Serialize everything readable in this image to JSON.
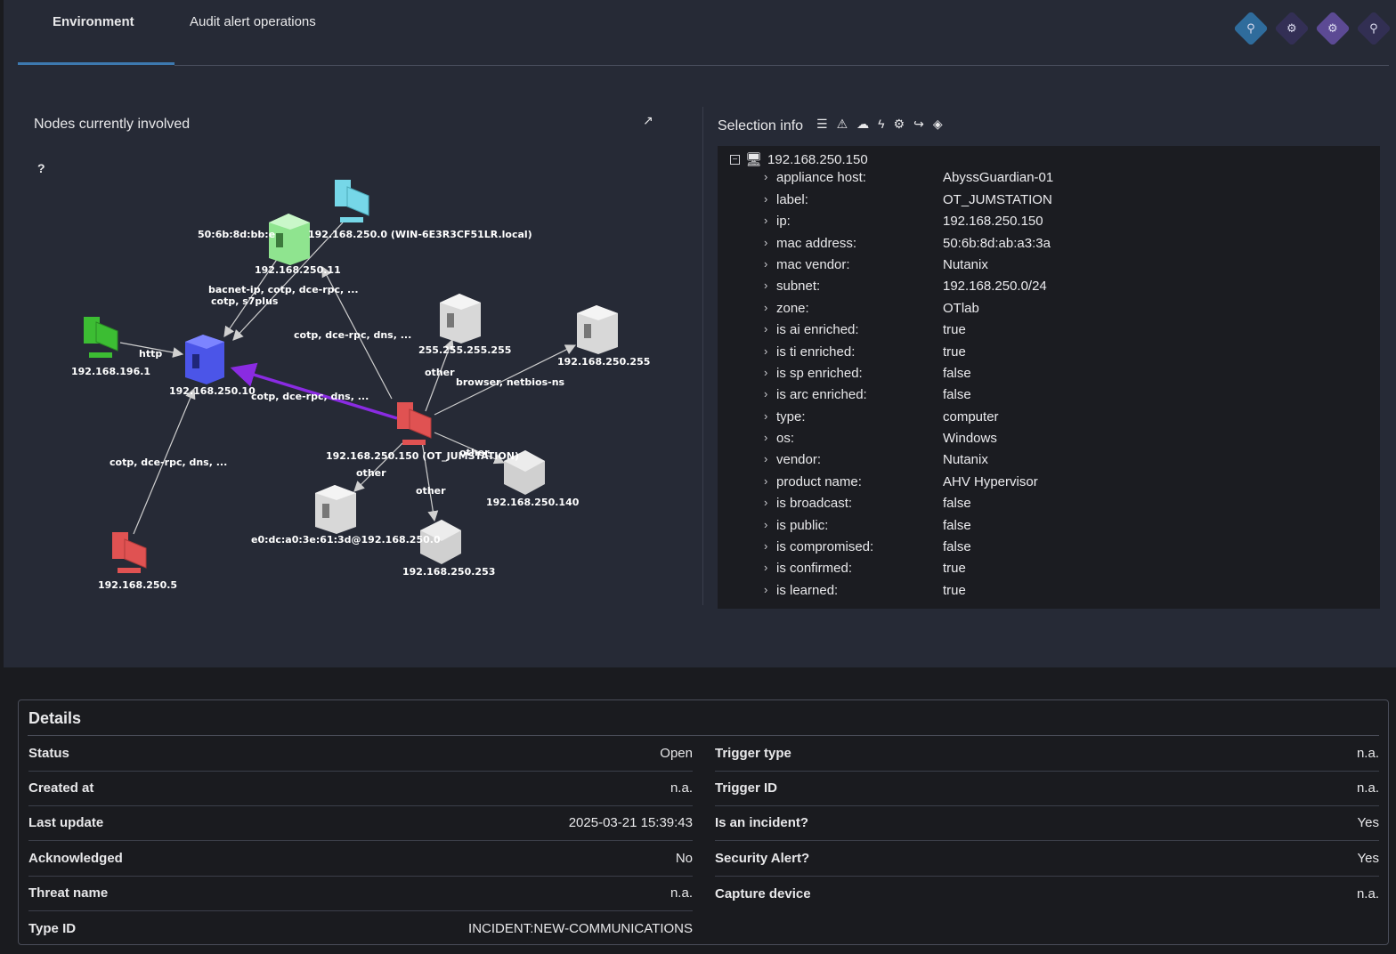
{
  "tabs": [
    {
      "label": "Environment",
      "active": true
    },
    {
      "label": "Audit alert operations",
      "active": false
    }
  ],
  "header_icons": [
    "appliance-icon",
    "settings-cog-icon",
    "network-node-icon",
    "extra-icon"
  ],
  "graph": {
    "title": "Nodes currently involved",
    "help": "?",
    "nodes": [
      {
        "id": "n10",
        "label": "192.168.250.10",
        "kind": "plc",
        "color": "#4b55e8"
      },
      {
        "id": "n1",
        "label": "192.168.196.1",
        "kind": "computer",
        "color": "#3cbd33"
      },
      {
        "id": "n11",
        "label": "192.168.250.11",
        "kind": "plc",
        "color": "#8fe48f"
      },
      {
        "id": "nwin",
        "label": "192.168.250.0 (WIN-6E3R3CF51LR.local)",
        "kind": "computer",
        "color": "#76d7e8"
      },
      {
        "id": "nmac",
        "label": "50:6b:8d:bb:e",
        "kind": "text",
        "color": "#ffffff"
      },
      {
        "id": "n255",
        "label": "255.255.255.255",
        "kind": "plc",
        "color": "#d8d8d8"
      },
      {
        "id": "n250255",
        "label": "192.168.250.255",
        "kind": "plc",
        "color": "#d8d8d8"
      },
      {
        "id": "n150",
        "label": "192.168.250.150 (OT_JUMSTATION)",
        "kind": "computer",
        "color": "#e05252"
      },
      {
        "id": "n140",
        "label": "192.168.250.140",
        "kind": "cube",
        "color": "#d8d8d8"
      },
      {
        "id": "n253",
        "label": "192.168.250.253",
        "kind": "cube",
        "color": "#d8d8d8"
      },
      {
        "id": "ne0",
        "label": "e0:dc:a0:3e:61:3d@192.168.250.0",
        "kind": "plc",
        "color": "#d8d8d8"
      },
      {
        "id": "n5",
        "label": "192.168.250.5",
        "kind": "computer",
        "color": "#e05252"
      }
    ],
    "edge_labels": [
      "bacnet-ip, cotp, dce-rpc, ...",
      "cotp, s7plus",
      "http",
      "cotp, dce-rpc, dns, ...",
      "cotp, dce-rpc, dns, ...",
      "other",
      "browser, netbios-ns",
      "other",
      "other",
      "other",
      "cotp, dce-rpc, dns, ..."
    ]
  },
  "selection": {
    "title": "Selection info",
    "root": "192.168.250.150",
    "rows": [
      {
        "key": "appliance host:",
        "value": "AbyssGuardian-01"
      },
      {
        "key": "label:",
        "value": "OT_JUMSTATION"
      },
      {
        "key": "ip:",
        "value": "192.168.250.150"
      },
      {
        "key": "mac address:",
        "value": "50:6b:8d:ab:a3:3a"
      },
      {
        "key": "mac vendor:",
        "value": "Nutanix"
      },
      {
        "key": "subnet:",
        "value": "192.168.250.0/24"
      },
      {
        "key": "zone:",
        "value": "OTlab"
      },
      {
        "key": "is ai enriched:",
        "value": "true"
      },
      {
        "key": "is ti enriched:",
        "value": "true"
      },
      {
        "key": "is sp enriched:",
        "value": "false"
      },
      {
        "key": "is arc enriched:",
        "value": "false"
      },
      {
        "key": "type:",
        "value": "computer"
      },
      {
        "key": "os:",
        "value": "Windows"
      },
      {
        "key": "vendor:",
        "value": "Nutanix"
      },
      {
        "key": "product name:",
        "value": "AHV Hypervisor"
      },
      {
        "key": "is broadcast:",
        "value": "false"
      },
      {
        "key": "is public:",
        "value": "false"
      },
      {
        "key": "is compromised:",
        "value": "false"
      },
      {
        "key": "is confirmed:",
        "value": "true"
      },
      {
        "key": "is learned:",
        "value": "true"
      }
    ]
  },
  "details": {
    "title": "Details",
    "left": [
      {
        "label": "Status",
        "value": "Open"
      },
      {
        "label": "Created at",
        "value": "n.a."
      },
      {
        "label": "Last update",
        "value": "2025-03-21 15:39:43"
      },
      {
        "label": "Acknowledged",
        "value": "No"
      },
      {
        "label": "Threat name",
        "value": "n.a."
      },
      {
        "label": "Type ID",
        "value": "INCIDENT:NEW-COMMUNICATIONS"
      }
    ],
    "right": [
      {
        "label": "Trigger type",
        "value": "n.a."
      },
      {
        "label": "Trigger ID",
        "value": "n.a."
      },
      {
        "label": "Is an incident?",
        "value": "Yes"
      },
      {
        "label": "Security Alert?",
        "value": "Yes"
      },
      {
        "label": "Capture device",
        "value": "n.a."
      }
    ]
  }
}
